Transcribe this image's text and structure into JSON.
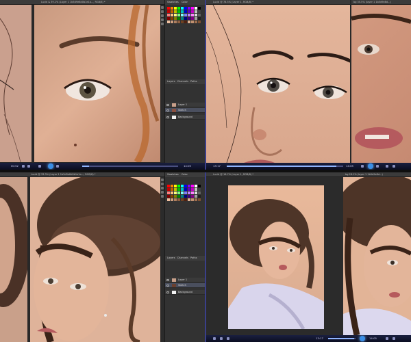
{
  "panes": {
    "top_left": {
      "tab_text": "Lucid & 39.1% (Layer 1 1b5d9e8d0b1e1a..., RGB/8) *",
      "panel_tabs": [
        "Swatches",
        "Color"
      ],
      "layers_tabs": [
        "Layers",
        "Channels",
        "Paths"
      ],
      "layers": [
        "Layer 1",
        "Sketch",
        "Background"
      ],
      "time_left": "00:52",
      "time_right": "14:05",
      "seek_fraction": 0.07
    },
    "top_right": {
      "tab_text": "Lucid @ 78.5% (Layer 1, RGB/8) *",
      "tab_text_2": "bg 35.5% (layer 1 1b5d9e8d...)",
      "time_left": "13:17",
      "time_right": "14:05",
      "seek_fraction": 0.94
    },
    "bottom_left": {
      "tab_text": "Lucid @ 33.3% (Layer 1 1b5d9e8d0b1e1a..., RGB/8) *",
      "panel_tabs": [
        "Swatches",
        "Color"
      ],
      "layers_tabs": [
        "Layers",
        "Channels",
        "Paths"
      ],
      "layers": [
        "Layer 1",
        "Sketch",
        "Background"
      ]
    },
    "bottom_right": {
      "tab_text": "Lucid @ 16.7% (Layer 1, RGB/8) *",
      "tab_text_2": "bg 28.1% (layer 1 1b5d9e8d...)",
      "time_left": "13:17",
      "time_right": "14:05",
      "seek_fraction": 0.94
    }
  },
  "colors": {
    "skin": "#d8a68c",
    "canvas_bg": "#e7b89a",
    "dark_ui": "#282828",
    "taskbar": "#0f1230",
    "accent": "#3a8ee6"
  }
}
